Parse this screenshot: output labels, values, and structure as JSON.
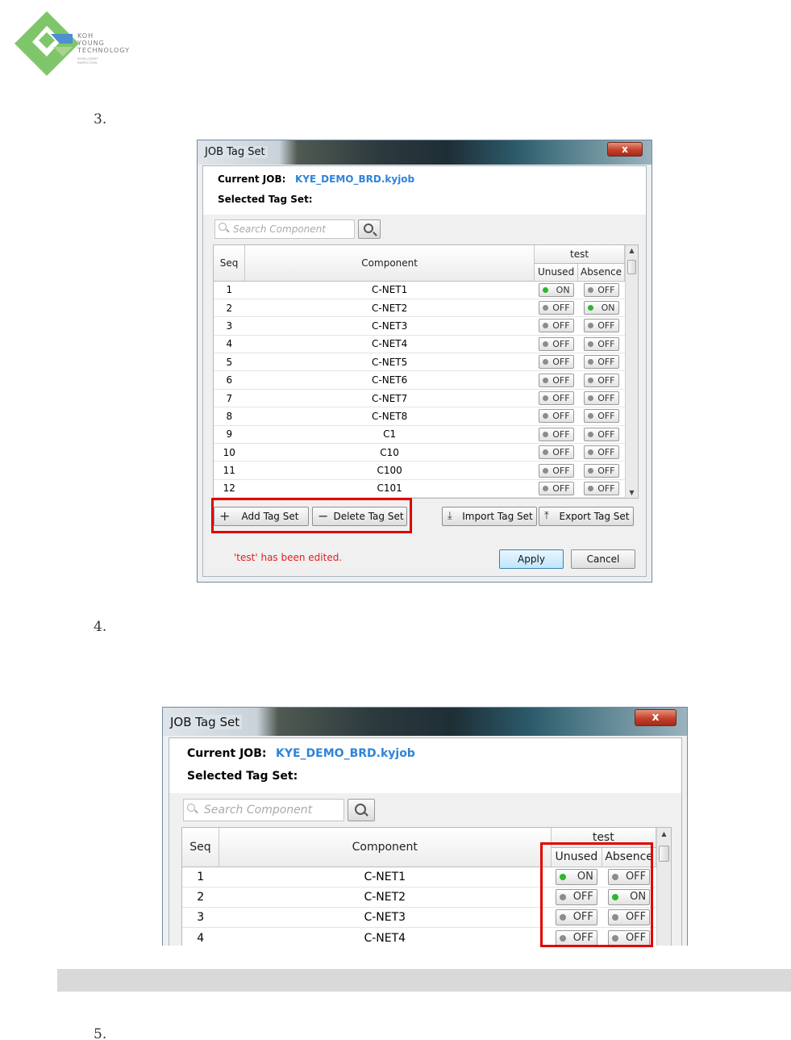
{
  "logo": {
    "lines": [
      "KOH",
      "YOUNG",
      "TECHNOLOGY"
    ],
    "small_lines": [
      "INTELLIGENT",
      "INSPECTION"
    ],
    "colors": {
      "green": "#7fc66a",
      "blue": "#4e8fcf"
    }
  },
  "steps": {
    "s3": "3.",
    "s4": "4.",
    "s5": "5."
  },
  "dialog1": {
    "title": "JOB Tag Set",
    "close_label": "x",
    "current_job_label": "Current JOB:",
    "current_job_value": "KYE_DEMO_BRD.kyjob",
    "selected_tag_set_label": "Selected Tag Set:",
    "search_placeholder": "Search Component",
    "columns": {
      "seq": "Seq",
      "component": "Component",
      "group": "test",
      "unused": "Unused",
      "absence": "Absence"
    },
    "rows": [
      {
        "seq": "1",
        "component": "C-NET1",
        "unused": "ON",
        "absence": "OFF"
      },
      {
        "seq": "2",
        "component": "C-NET2",
        "unused": "OFF",
        "absence": "ON"
      },
      {
        "seq": "3",
        "component": "C-NET3",
        "unused": "OFF",
        "absence": "OFF"
      },
      {
        "seq": "4",
        "component": "C-NET4",
        "unused": "OFF",
        "absence": "OFF"
      },
      {
        "seq": "5",
        "component": "C-NET5",
        "unused": "OFF",
        "absence": "OFF"
      },
      {
        "seq": "6",
        "component": "C-NET6",
        "unused": "OFF",
        "absence": "OFF"
      },
      {
        "seq": "7",
        "component": "C-NET7",
        "unused": "OFF",
        "absence": "OFF"
      },
      {
        "seq": "8",
        "component": "C-NET8",
        "unused": "OFF",
        "absence": "OFF"
      },
      {
        "seq": "9",
        "component": "C1",
        "unused": "OFF",
        "absence": "OFF"
      },
      {
        "seq": "10",
        "component": "C10",
        "unused": "OFF",
        "absence": "OFF"
      },
      {
        "seq": "11",
        "component": "C100",
        "unused": "OFF",
        "absence": "OFF"
      },
      {
        "seq": "12",
        "component": "C101",
        "unused": "OFF",
        "absence": "OFF"
      }
    ],
    "buttons": {
      "add_tag_set": "Add Tag Set",
      "delete_tag_set": "Delete Tag Set",
      "import_tag_set": "Import Tag Set",
      "export_tag_set": "Export Tag Set",
      "apply": "Apply",
      "cancel": "Cancel"
    },
    "status_message": "'test' has been edited."
  },
  "dialog2": {
    "title": "JOB Tag Set",
    "close_label": "x",
    "current_job_label": "Current JOB:",
    "current_job_value": "KYE_DEMO_BRD.kyjob",
    "selected_tag_set_label": "Selected Tag Set:",
    "search_placeholder": "Search Component",
    "columns": {
      "seq": "Seq",
      "component": "Component",
      "group": "test",
      "unused": "Unused",
      "absence": "Absence"
    },
    "rows": [
      {
        "seq": "1",
        "component": "C-NET1",
        "unused": "ON",
        "absence": "OFF"
      },
      {
        "seq": "2",
        "component": "C-NET2",
        "unused": "OFF",
        "absence": "ON"
      },
      {
        "seq": "3",
        "component": "C-NET3",
        "unused": "OFF",
        "absence": "OFF"
      },
      {
        "seq": "4",
        "component": "C-NET4",
        "unused": "OFF",
        "absence": "OFF"
      }
    ]
  },
  "highlight_color": "#e00000"
}
